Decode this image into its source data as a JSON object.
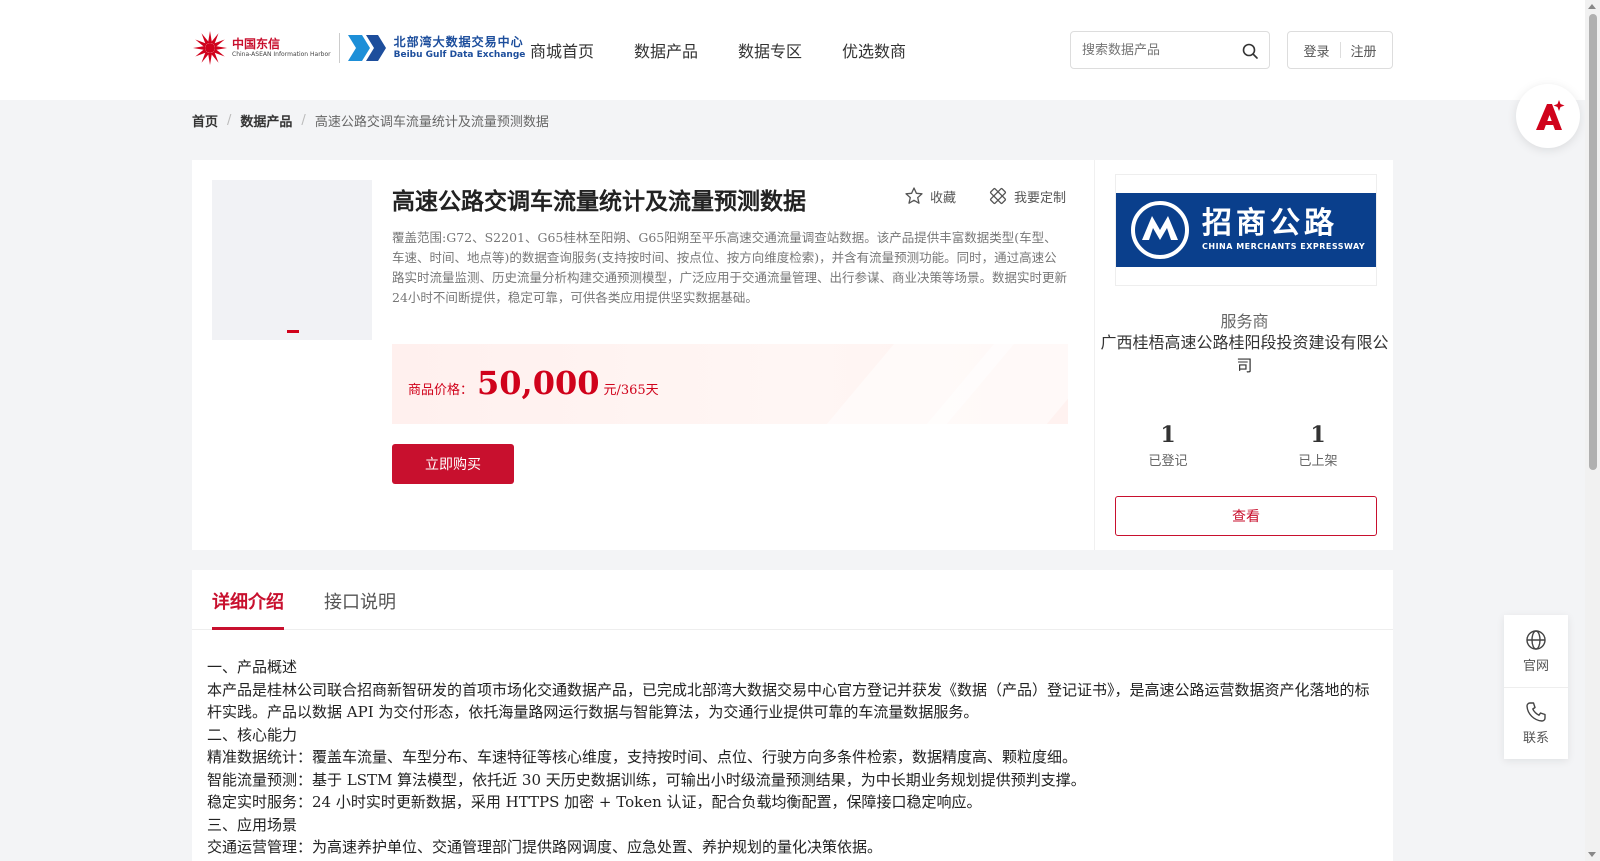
{
  "header": {
    "logo_cta": {
      "cn": "中国东信",
      "en": "China-ASEAN Information Harbor"
    },
    "logo_bgde": {
      "cn": "北部湾大数据交易中心",
      "en": "Beibu Gulf Data Exchange"
    },
    "nav": [
      {
        "label": "商城首页"
      },
      {
        "label": "数据产品"
      },
      {
        "label": "数据专区"
      },
      {
        "label": "优选数商"
      }
    ],
    "search_placeholder": "搜索数据产品",
    "login_label": "登录",
    "register_label": "注册"
  },
  "breadcrumb": {
    "home": "首页",
    "section": "数据产品",
    "current": "高速公路交调车流量统计及流量预测数据"
  },
  "product": {
    "title": "高速公路交调车流量统计及流量预测数据",
    "favorite_label": "收藏",
    "customize_label": "我要定制",
    "description": "覆盖范围:G72、S2201、G65桂林至阳朔、G65阳朔至平乐高速交通流量调查站数据。该产品提供丰富数据类型(车型、车速、时间、地点等)的数据查询服务(支持按时间、按点位、按方向维度检索)，并含有流量预测功能。同时，通过高速公路实时流量监测、历史流量分析构建交通预测模型，广泛应用于交通流量管理、出行参谋、商业决策等场景。数据实时更新24小时不间断提供，稳定可靠，可供各类应用提供坚实数据基础。",
    "price_label": "商品价格：",
    "price_value": "50,000",
    "price_unit": "元/365天",
    "buy_label": "立即购买",
    "accent_color": "#c8102e"
  },
  "vendor": {
    "logo": {
      "cn": "招商公路",
      "en": "CHINA MERCHANTS EXPRESSWAY"
    },
    "role": "服务商",
    "name": "广西桂梧高速公路桂阳段投资建设有限公司",
    "stats": [
      {
        "value": "1",
        "label": "已登记"
      },
      {
        "value": "1",
        "label": "已上架"
      }
    ],
    "view_label": "查看"
  },
  "details": {
    "tabs": [
      {
        "label": "详细介绍",
        "active": true
      },
      {
        "label": "接口说明",
        "active": false
      }
    ],
    "lines": [
      "一、产品概述",
      "本产品是桂林公司联合招商新智研发的首项市场化交通数据产品，已完成北部湾大数据交易中心官方登记并获发《数据（产品）登记证书》，是高速公路运营数据资产化落地的标杆实践。产品以数据 API 为交付形态，依托海量路网运行数据与智能算法，为交通行业提供可靠的车流量数据服务。",
      "二、核心能力",
      "精准数据统计：覆盖车流量、车型分布、车速特征等核心维度，支持按时间、点位、行驶方向多条件检索，数据精度高、颗粒度细。",
      "智能流量预测：基于 LSTM 算法模型，依托近 30 天历史数据训练，可输出小时级流量预测结果，为中长期业务规划提供预判支撑。",
      "稳定实时服务：24 小时实时更新数据，采用 HTTPS 加密 + Token 认证，配合负载均衡配置，保障接口稳定响应。",
      "三、应用场景",
      "交通运营管理：为高速养护单位、交通管理部门提供路网调度、应急处置、养护规划的量化决策依据。"
    ]
  },
  "side_float": {
    "official_label": "官网",
    "contact_label": "联系"
  }
}
